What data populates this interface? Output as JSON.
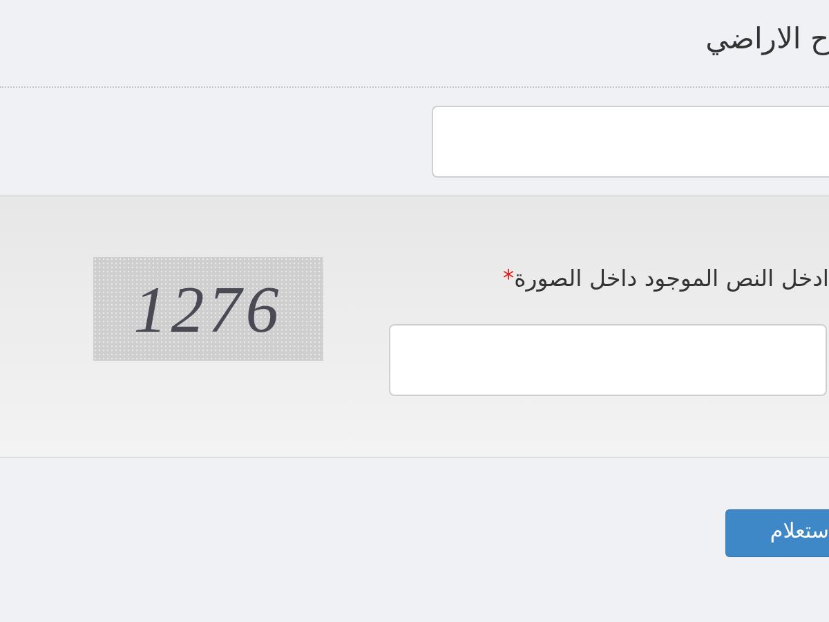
{
  "header": {
    "title": "ح الاراضي"
  },
  "captcha_section": {
    "label": "ادخل النص الموجود داخل الصورة",
    "required_mark": "*",
    "captcha": {
      "text": "1276"
    }
  },
  "submit_button": {
    "label": "ستعلام"
  }
}
